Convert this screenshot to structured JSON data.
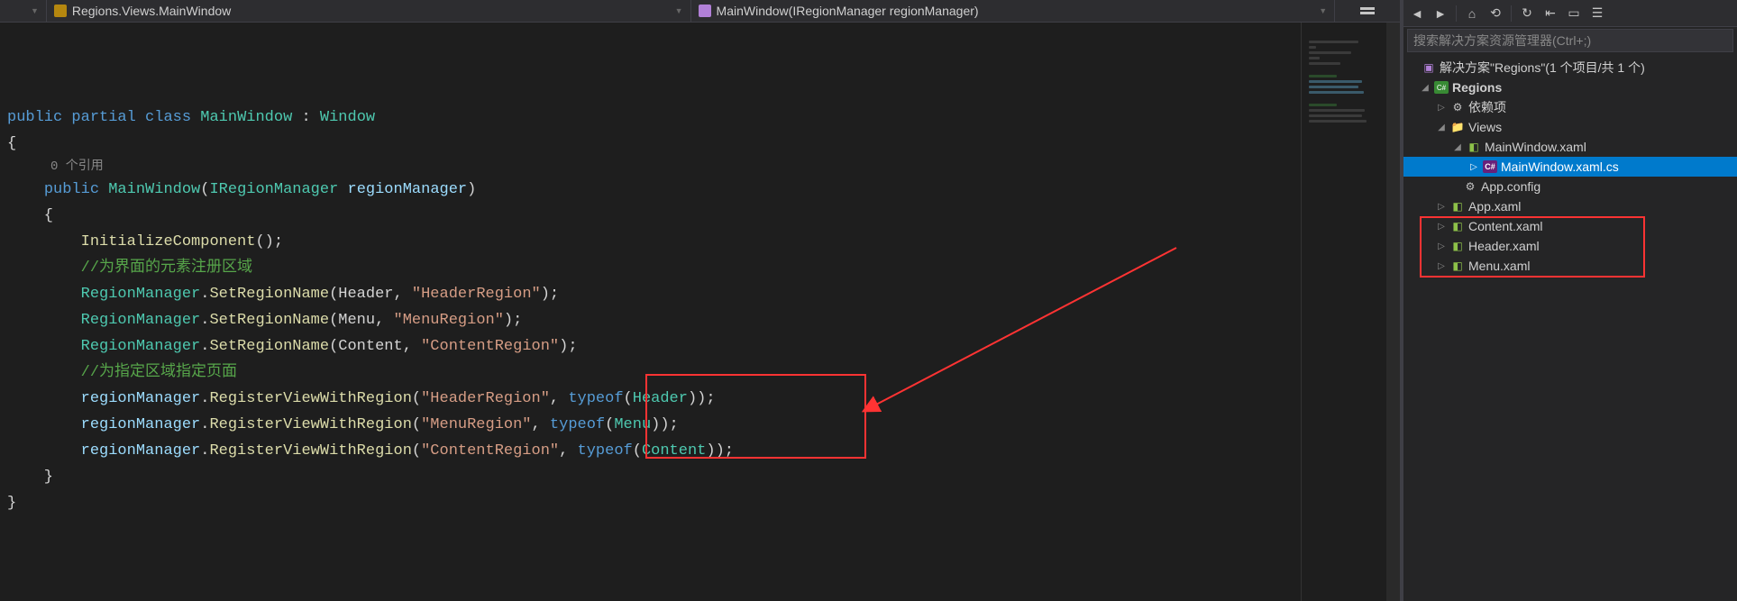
{
  "breadcrumb": {
    "class_path": "Regions.Views.MainWindow",
    "method_sig": "MainWindow(IRegionManager regionManager)"
  },
  "code": {
    "lens": "0 个引用",
    "lines": [
      {
        "t": "plain",
        "html": "<span class='kw'>public</span> <span class='kw'>partial</span> <span class='kw'>class</span> <span class='type'>MainWindow</span> : <span class='type'>Window</span>"
      },
      {
        "t": "plain",
        "html": "{"
      },
      {
        "t": "lens"
      },
      {
        "t": "plain",
        "html": "    <span class='kw'>public</span> <span class='type'>MainWindow</span>(<span class='type'>IRegionManager</span> <span class='param'>regionManager</span>)"
      },
      {
        "t": "plain",
        "html": "    {"
      },
      {
        "t": "plain",
        "html": "        <span class='method'>InitializeComponent</span>();"
      },
      {
        "t": "plain",
        "html": ""
      },
      {
        "t": "plain",
        "html": "        <span class='comment'>//为界面的元素注册区域</span>"
      },
      {
        "t": "plain",
        "html": "        <span class='type'>RegionManager</span>.<span class='method'>SetRegionName</span>(Header, <span class='str'>\"HeaderRegion\"</span>);"
      },
      {
        "t": "plain",
        "html": "        <span class='type'>RegionManager</span>.<span class='method'>SetRegionName</span>(Menu, <span class='str'>\"MenuRegion\"</span>);"
      },
      {
        "t": "plain",
        "html": "        <span class='type'>RegionManager</span>.<span class='method'>SetRegionName</span>(Content, <span class='str'>\"ContentRegion\"</span>);"
      },
      {
        "t": "plain",
        "html": ""
      },
      {
        "t": "plain",
        "html": "        <span class='comment'>//为指定区域指定页面</span>"
      },
      {
        "t": "plain",
        "html": "        <span class='param'>regionManager</span>.<span class='method'>RegisterViewWithRegion</span>(<span class='str'>\"HeaderRegion\"</span>, <span class='kw'>typeof</span>(<span class='type'>Header</span>));"
      },
      {
        "t": "plain",
        "html": "        <span class='param'>regionManager</span>.<span class='method'>RegisterViewWithRegion</span>(<span class='str'>\"MenuRegion\"</span>, <span class='kw'>typeof</span>(<span class='type'>Menu</span>));"
      },
      {
        "t": "plain",
        "html": "        <span class='param'>regionManager</span>.<span class='method'>RegisterViewWithRegion</span>(<span class='str'>\"ContentRegion\"</span>, <span class='kw'>typeof</span>(<span class='type'>Content</span>));"
      },
      {
        "t": "plain",
        "html": "    }"
      },
      {
        "t": "plain",
        "html": "}"
      }
    ]
  },
  "search": {
    "placeholder": "搜索解决方案资源管理器(Ctrl+;)"
  },
  "solution": {
    "root": "解决方案\"Regions\"(1 个项目/共 1 个)",
    "project": "Regions",
    "deps": "依赖项",
    "views_folder": "Views",
    "mainwindow_xaml": "MainWindow.xaml",
    "mainwindow_cs": "MainWindow.xaml.cs",
    "app_config": "App.config",
    "app_xaml": "App.xaml",
    "content_xaml": "Content.xaml",
    "header_xaml": "Header.xaml",
    "menu_xaml": "Menu.xaml"
  }
}
